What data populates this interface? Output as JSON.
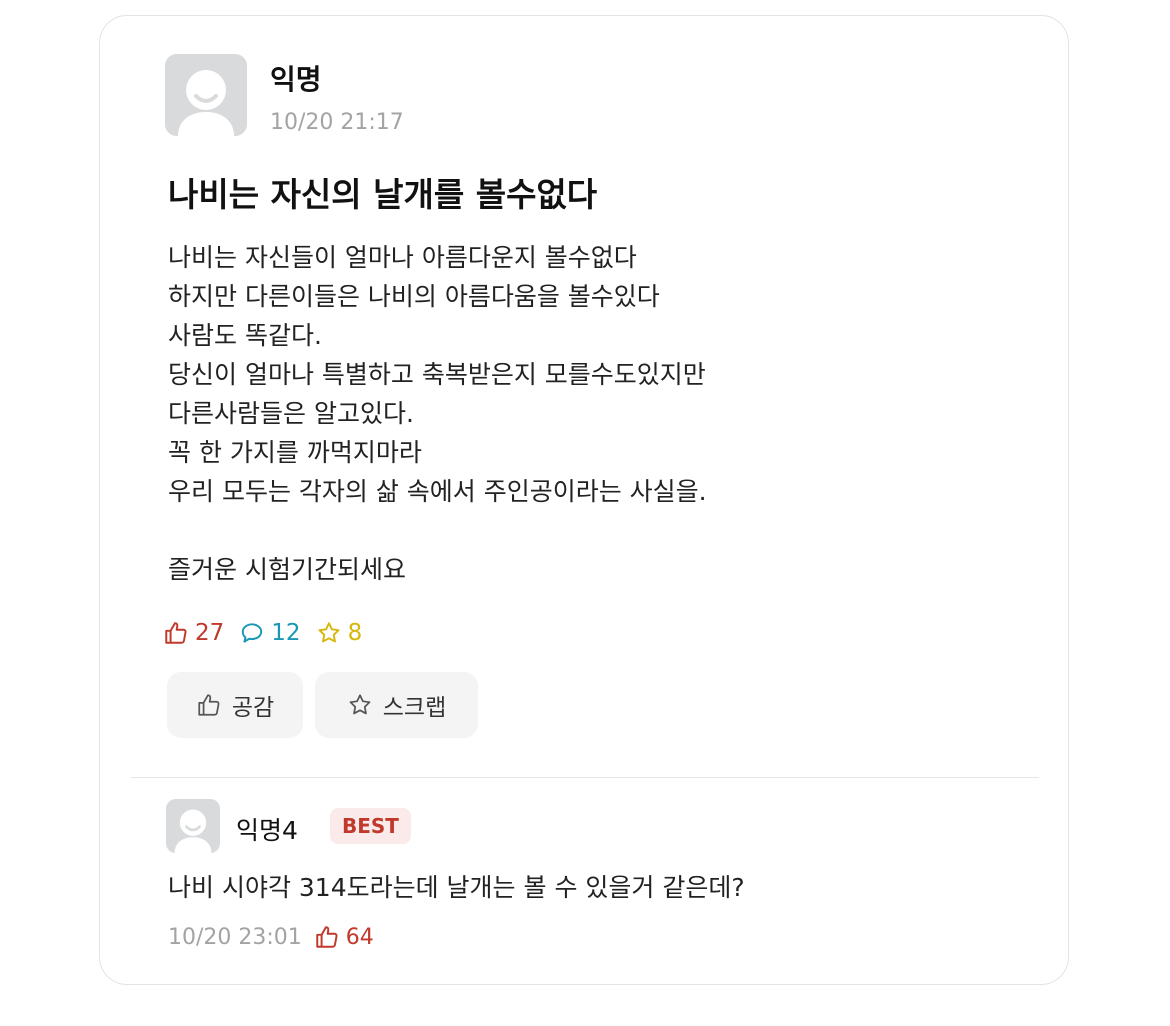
{
  "post": {
    "author": "익명",
    "time": "10/20 21:17",
    "title": "나비는 자신의 날개를 볼수없다",
    "body_lines": [
      "나비는 자신들이 얼마나 아름다운지 볼수없다",
      "하지만 다른이들은 나비의 아름다움을 볼수있다",
      "사람도 똑같다.",
      "당신이 얼마나 특별하고 축복받은지 모를수도있지만",
      "다른사람들은 알고있다.",
      "꼭 한 가지를 까먹지마라",
      "우리 모두는 각자의 삶 속에서 주인공이라는 사실을.",
      "",
      "즐거운 시험기간되세요"
    ],
    "stats": {
      "likes": "27",
      "comments": "12",
      "scraps": "8"
    },
    "buttons": {
      "like_label": "공감",
      "scrap_label": "스크랩"
    }
  },
  "comment": {
    "author": "익명4",
    "badge": "BEST",
    "text": "나비 시야각 314도라는데 날개는 볼 수 있을거 같은데?",
    "time": "10/20 23:01",
    "likes": "64"
  },
  "colors": {
    "likes": "#c0392b",
    "comments": "#1a97b6",
    "scraps": "#d6b70e",
    "muted_text": "#a3a3a3",
    "avatar_bg": "#d9dadb"
  },
  "icons": {
    "like": "thumbs-up-icon",
    "comment": "speech-bubble-icon",
    "scrap": "star-icon",
    "avatar": "default-avatar-icon"
  }
}
